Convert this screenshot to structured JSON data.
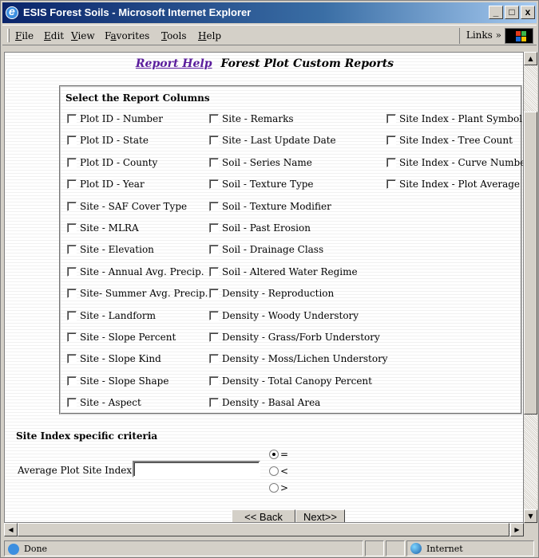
{
  "window": {
    "title": "ESIS Forest Soils - Microsoft Internet Explorer",
    "min": "_",
    "max": "□",
    "close": "x"
  },
  "menu": {
    "items": [
      {
        "label": "File",
        "u": "F",
        "rest": "ile"
      },
      {
        "label": "Edit",
        "u": "E",
        "rest": "dit"
      },
      {
        "label": "View",
        "u": "V",
        "rest": "iew"
      },
      {
        "label": "Favorites",
        "u": "a",
        "pre": "F",
        "rest": "vorites"
      },
      {
        "label": "Tools",
        "u": "T",
        "rest": "ools"
      },
      {
        "label": "Help",
        "u": "H",
        "rest": "elp"
      }
    ],
    "links": "Links »"
  },
  "page": {
    "help_link": "Report Help",
    "heading": "Forest Plot Custom Reports",
    "legend": "Select the Report Columns",
    "columns": [
      [
        "Plot ID - Number",
        "Plot ID - State",
        "Plot ID - County",
        "Plot ID - Year",
        "Site - SAF Cover Type",
        "Site - MLRA",
        "Site - Elevation",
        "Site - Annual Avg. Precip.",
        "Site- Summer Avg. Precip.",
        "Site - Landform",
        "Site - Slope Percent",
        "Site - Slope Kind",
        "Site - Slope Shape",
        "Site - Aspect"
      ],
      [
        "Site - Remarks",
        "Site - Last Update Date",
        "Soil - Series Name",
        "Soil - Texture Type",
        "Soil - Texture Modifier",
        "Soil - Past Erosion",
        "Soil - Drainage Class",
        "Soil - Altered Water Regime",
        "Density - Reproduction",
        "Density - Woody Understory",
        "Density - Grass/Forb Understory",
        "Density - Moss/Lichen Understory",
        "Density - Total Canopy Percent",
        "Density - Basal Area"
      ],
      [
        "Site Index - Plant Symbol",
        "Site Index - Tree Count",
        "Site Index - Curve Number",
        "Site Index - Plot Average"
      ]
    ],
    "criteria_title": "Site Index specific criteria",
    "avg_label": "Average Plot Site Index:",
    "avg_value": "",
    "radios": [
      {
        "label": "=",
        "checked": true
      },
      {
        "label": "<",
        "checked": false
      },
      {
        "label": ">",
        "checked": false
      }
    ],
    "back": "<< Back",
    "next": "Next>>"
  },
  "status": {
    "text": "Done",
    "zone": "Internet"
  }
}
